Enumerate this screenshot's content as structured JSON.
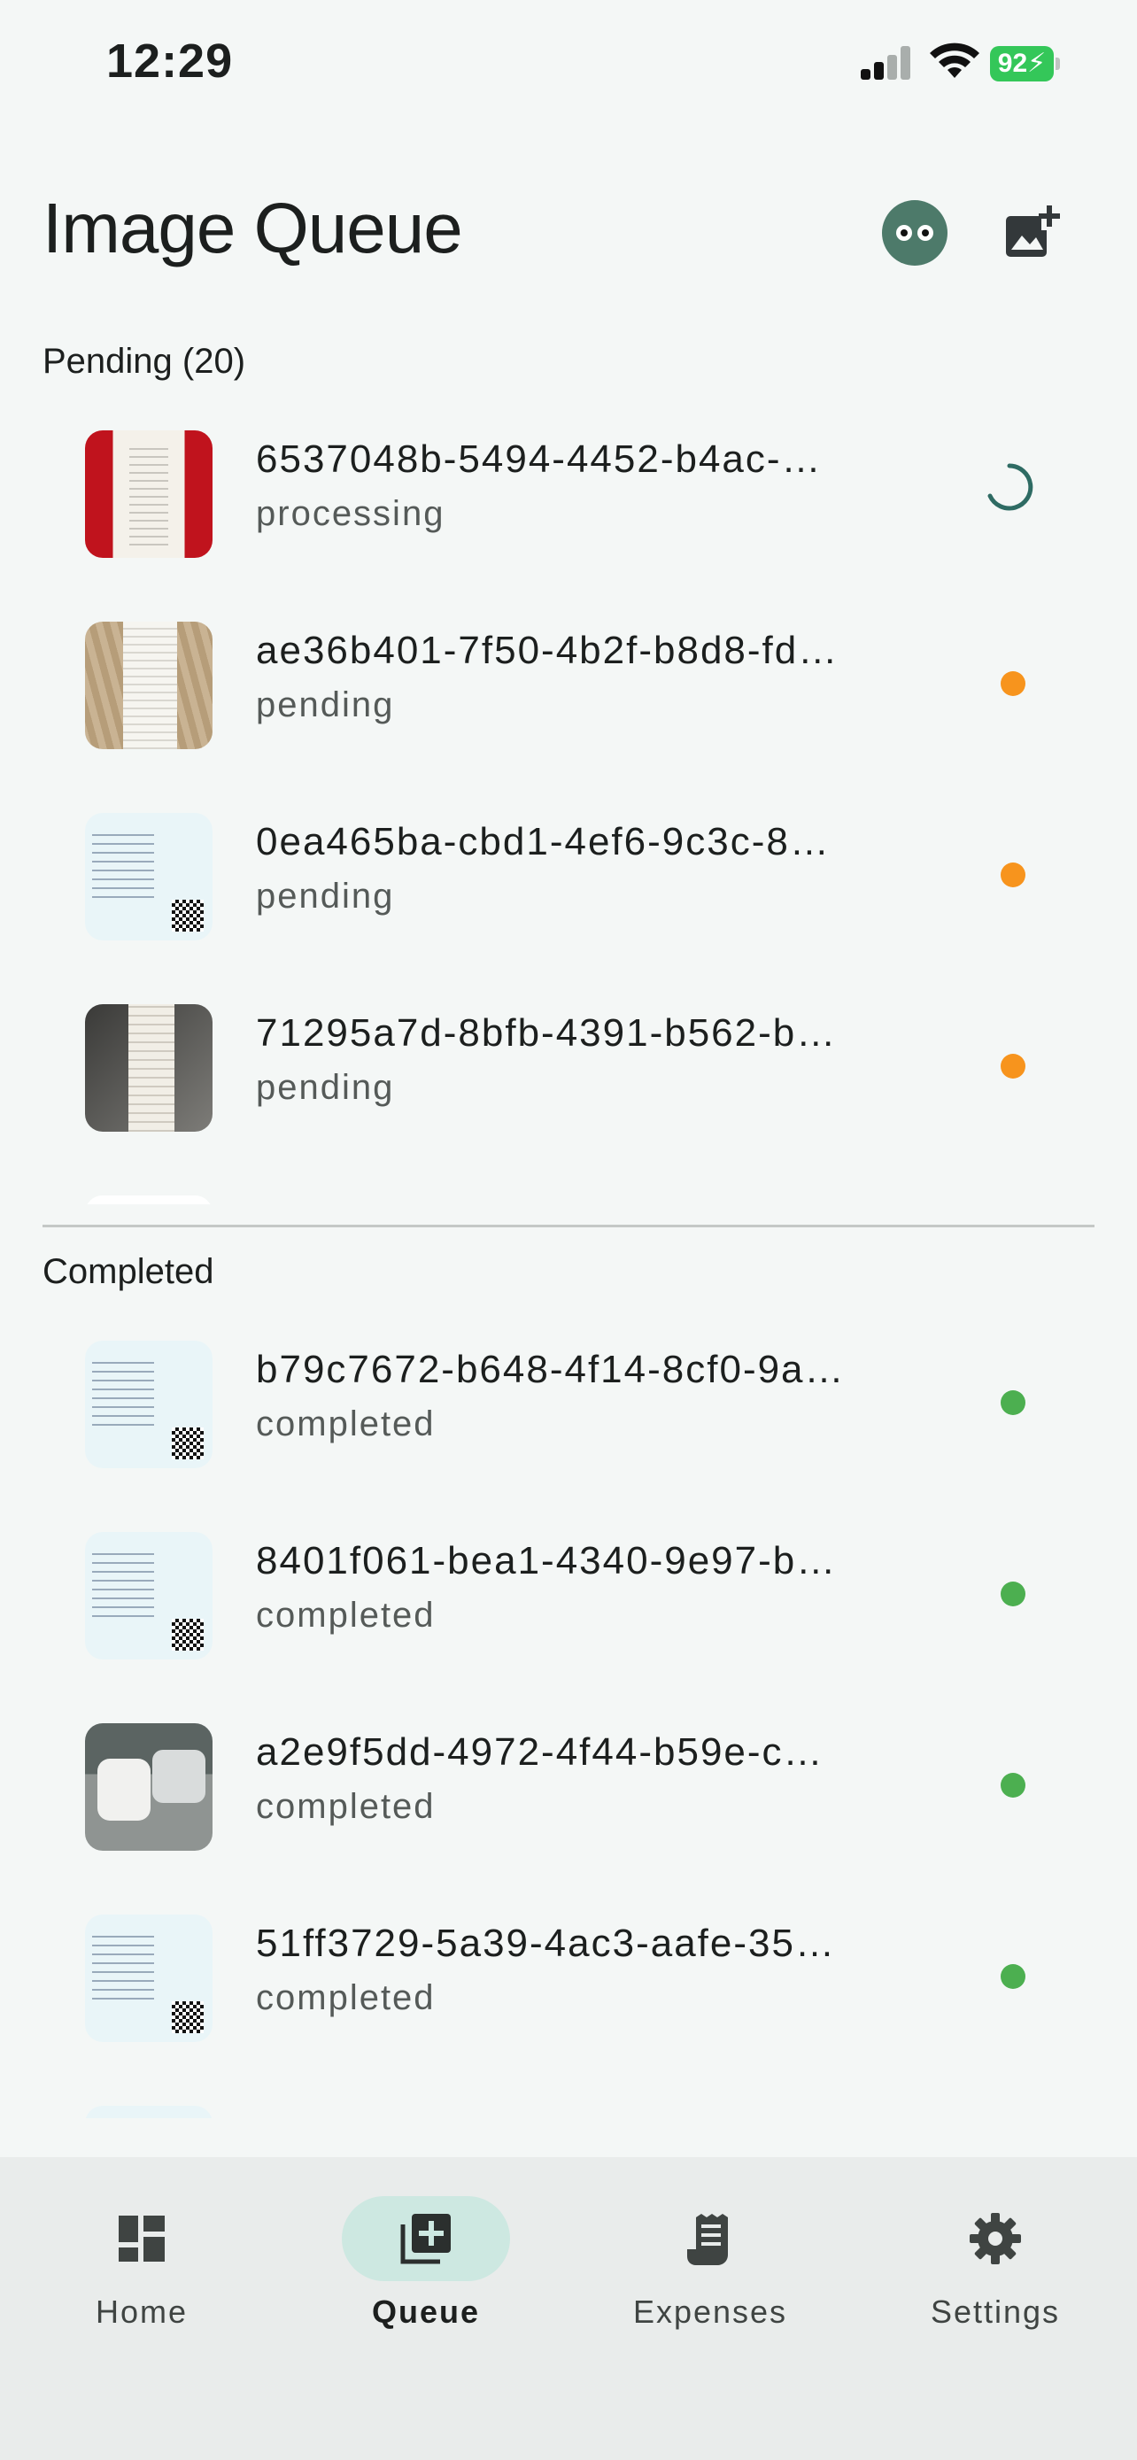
{
  "status_bar": {
    "time": "12:29",
    "battery": "92"
  },
  "header": {
    "title": "Image Queue",
    "avatar_icon": "avatar-face",
    "add_icon": "add-photo-icon"
  },
  "pending": {
    "label": "Pending (20)",
    "items": [
      {
        "name": "6537048b-5494-4452-b4ac-…",
        "status": "processing",
        "indicator": "spinner",
        "thumb": "red-receipt"
      },
      {
        "name": "ae36b401-7f50-4b2f-b8d8-fd…",
        "status": "pending",
        "indicator": "#f7941d",
        "thumb": "wood-receipt"
      },
      {
        "name": "0ea465ba-cbd1-4ef6-9c3c-8…",
        "status": "pending",
        "indicator": "#f7941d",
        "thumb": "bank-slip"
      },
      {
        "name": "71295a7d-8bfb-4391-b562-b…",
        "status": "pending",
        "indicator": "#f7941d",
        "thumb": "dark-receipt"
      }
    ]
  },
  "completed": {
    "label": "Completed",
    "items": [
      {
        "name": "b79c7672-b648-4f14-8cf0-9a…",
        "status": "completed",
        "indicator": "#4caf50",
        "thumb": "bank-slip"
      },
      {
        "name": "8401f061-bea1-4340-9e97-b…",
        "status": "completed",
        "indicator": "#4caf50",
        "thumb": "bank-slip"
      },
      {
        "name": "a2e9f5dd-4972-4f44-b59e-c…",
        "status": "completed",
        "indicator": "#4caf50",
        "thumb": "car-photo"
      },
      {
        "name": "51ff3729-5a39-4ac3-aafe-35…",
        "status": "completed",
        "indicator": "#4caf50",
        "thumb": "bank-slip"
      }
    ]
  },
  "nav": {
    "items": [
      {
        "label": "Home",
        "icon": "dashboard-icon"
      },
      {
        "label": "Queue",
        "icon": "queue-icon",
        "active": true
      },
      {
        "label": "Expenses",
        "icon": "receipt-icon"
      },
      {
        "label": "Settings",
        "icon": "gear-icon"
      }
    ]
  },
  "colors": {
    "accent": "#2e6b63",
    "pending": "#f7941d",
    "completed": "#4caf50",
    "nav_active": "#cde8e1"
  }
}
